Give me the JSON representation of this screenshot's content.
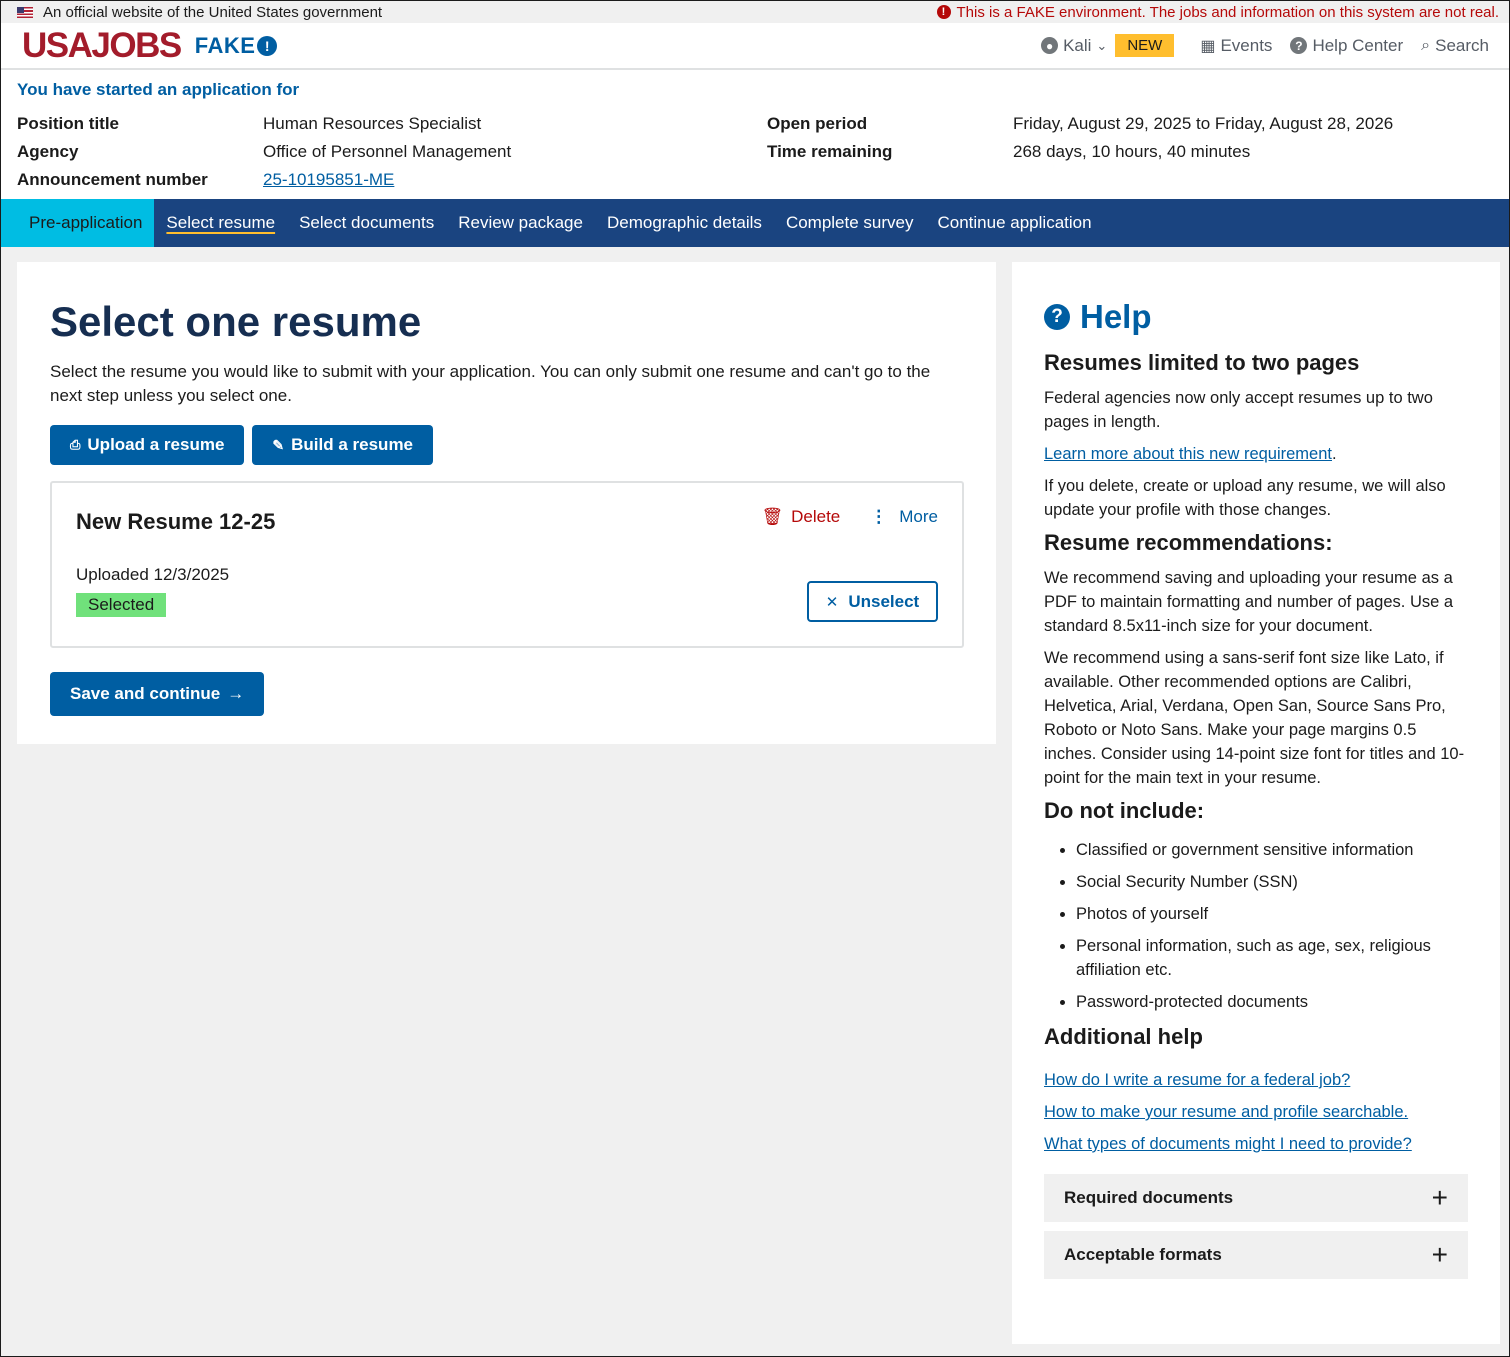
{
  "gov_banner": {
    "official_text": "An official website of the United States government",
    "fake_warning": "This is a FAKE environment. The jobs and information on this system are not real."
  },
  "header": {
    "logo": "USAJOBS",
    "fake_label": "FAKE",
    "user": "Kali",
    "new_badge": "NEW",
    "events": "Events",
    "help_center": "Help Center",
    "search": "Search"
  },
  "application": {
    "started_label": "You have started an application for",
    "position_label": "Position title",
    "position_value": "Human Resources Specialist",
    "agency_label": "Agency",
    "agency_value": "Office of Personnel Management",
    "announcement_label": "Announcement number",
    "announcement_value": "25-10195851-ME",
    "open_label": "Open period",
    "open_value": "Friday, August 29, 2025 to Friday, August 28, 2026",
    "remaining_label": "Time remaining",
    "remaining_value": "268 days, 10 hours, 40 minutes"
  },
  "steps": [
    "Pre-application",
    "Select resume",
    "Select documents",
    "Review package",
    "Demographic details",
    "Complete survey",
    "Continue application"
  ],
  "main": {
    "title": "Select one resume",
    "lead": "Select the resume you would like to submit with your application. You can only submit one resume and can't go to the next step unless you select one.",
    "upload_button": "Upload a resume",
    "build_button": "Build a resume",
    "resume": {
      "name": "New Resume 12-25",
      "uploaded": "Uploaded 12/3/2025",
      "status": "Selected",
      "delete": "Delete",
      "more": "More",
      "unselect": "Unselect"
    },
    "save_button": "Save and continue"
  },
  "help": {
    "title": "Help",
    "h_limit": "Resumes limited to two pages",
    "p_limit": "Federal agencies now only accept resumes up to two pages in length.",
    "learn_more": "Learn more about this new requirement",
    "p_update": "If you delete, create or upload any resume, we will also update your profile with those changes.",
    "h_recs": "Resume recommendations:",
    "p_recs1": "We recommend saving and uploading your resume as a PDF to maintain formatting and number of pages. Use a standard 8.5x11-inch size for your document.",
    "p_recs2": "We recommend using a sans-serif font size like Lato, if available. Other recommended options are Calibri, Helvetica, Arial, Verdana, Open San, Source Sans Pro, Roboto or Noto Sans. Make your page margins 0.5 inches. Consider using 14-point size font for titles and 10-point for the main text in your resume.",
    "h_exclude": "Do not include:",
    "exclude_items": [
      "Classified or government sensitive information",
      "Social Security Number (SSN)",
      "Photos of yourself",
      "Personal information, such as age, sex, religious affiliation etc.",
      "Password-protected documents"
    ],
    "h_additional": "Additional help",
    "links": [
      "How do I write a resume for a federal job?",
      "How to make your resume and profile searchable.",
      "What types of documents might I need to provide?"
    ],
    "accordion_required": "Required documents",
    "accordion_formats": "Acceptable formats"
  }
}
